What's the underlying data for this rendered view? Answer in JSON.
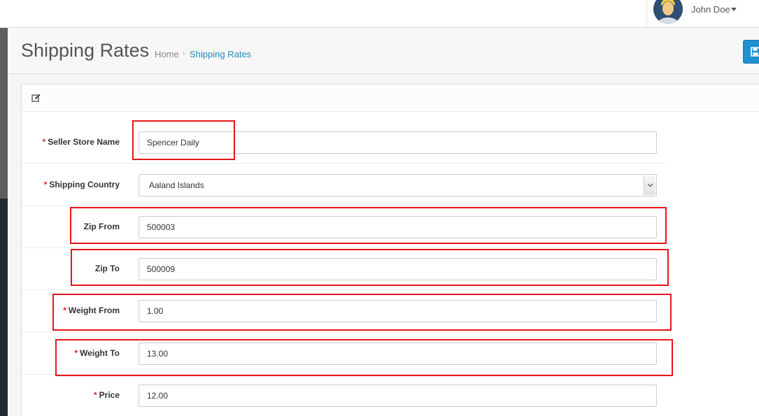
{
  "header": {
    "user_name": "John Doe"
  },
  "page": {
    "title": "Shipping Rates",
    "breadcrumb": {
      "home": "Home",
      "separator": "›",
      "current": "Shipping Rates"
    }
  },
  "form": {
    "fields": [
      {
        "label": "Seller Store Name",
        "required": true,
        "value": "Spencer Daily"
      },
      {
        "label": "Shipping Country",
        "required": true,
        "value": "Aaland Islands"
      },
      {
        "label": "Zip From",
        "required": false,
        "value": "500003"
      },
      {
        "label": "Zip To",
        "required": false,
        "value": "500009"
      },
      {
        "label": "Weight From",
        "required": true,
        "value": "1.00"
      },
      {
        "label": "Weight To",
        "required": true,
        "value": "13.00"
      },
      {
        "label": "Price",
        "required": true,
        "value": "12.00"
      }
    ],
    "required_marker": "*"
  },
  "icons": {
    "save": "floppy-disk-icon",
    "panel": "edit-icon",
    "user_menu": "caret-down-icon"
  },
  "colors": {
    "accent": "#1e91cf",
    "link": "#1f8bbd",
    "required": "#e31e24",
    "highlight": "#e8141b",
    "sidebar": "#1f2a33"
  }
}
